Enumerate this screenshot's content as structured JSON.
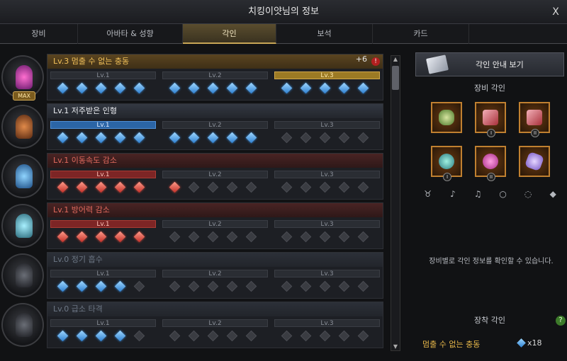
{
  "window": {
    "title": "치킹이얏님의 정보",
    "close": "X"
  },
  "tabs": [
    "장비",
    "아바타 & 성향",
    "각인",
    "보석",
    "카드"
  ],
  "engravings": [
    {
      "name": "Lv.3 멈출 수 없는 충동",
      "style": "gold",
      "bonus": "+6",
      "alert": "!",
      "avatar_max": "MAX",
      "segments": [
        {
          "label": "Lv.1",
          "gems": [
            "blue",
            "blue",
            "blue",
            "blue",
            "blue"
          ]
        },
        {
          "label": "Lv.2",
          "gems": [
            "blue",
            "blue",
            "blue",
            "blue",
            "blue"
          ]
        },
        {
          "label": "Lv.3",
          "fill": "gold",
          "gems": [
            "blue",
            "blue",
            "blue",
            "blue",
            "blue"
          ]
        }
      ]
    },
    {
      "name": "Lv.1 저주받은 인형",
      "style": "white",
      "segments": [
        {
          "label": "Lv.1",
          "fill": "blue",
          "gems": [
            "blue",
            "blue",
            "blue",
            "blue",
            "blue"
          ]
        },
        {
          "label": "Lv.2",
          "gems": [
            "blue",
            "blue",
            "blue",
            "blue",
            "blue"
          ]
        },
        {
          "label": "Lv.3",
          "gems": [
            "empty",
            "empty",
            "empty",
            "empty",
            "empty"
          ]
        }
      ]
    },
    {
      "name": "Lv.1 이동속도 감소",
      "style": "red",
      "segments": [
        {
          "label": "Lv.1",
          "fill": "red",
          "gems": [
            "red",
            "red",
            "red",
            "red",
            "red"
          ]
        },
        {
          "label": "Lv.2",
          "gems": [
            "red",
            "empty",
            "empty",
            "empty",
            "empty"
          ]
        },
        {
          "label": "Lv.3",
          "gems": [
            "empty",
            "empty",
            "empty",
            "empty",
            "empty"
          ]
        }
      ]
    },
    {
      "name": "Lv.1 방어력 감소",
      "style": "red",
      "segments": [
        {
          "label": "Lv.1",
          "fill": "red",
          "gems": [
            "red",
            "red",
            "red",
            "red",
            "red"
          ]
        },
        {
          "label": "Lv.2",
          "gems": [
            "empty",
            "empty",
            "empty",
            "empty",
            "empty"
          ]
        },
        {
          "label": "Lv.3",
          "gems": [
            "empty",
            "empty",
            "empty",
            "empty",
            "empty"
          ]
        }
      ]
    },
    {
      "name": "Lv.0 정기 흡수",
      "style": "grey",
      "segments": [
        {
          "label": "Lv.1",
          "gems": [
            "blue",
            "blue",
            "blue",
            "blue",
            "empty"
          ]
        },
        {
          "label": "Lv.2",
          "gems": [
            "empty",
            "empty",
            "empty",
            "empty",
            "empty"
          ]
        },
        {
          "label": "Lv.3",
          "gems": [
            "empty",
            "empty",
            "empty",
            "empty",
            "empty"
          ]
        }
      ]
    },
    {
      "name": "Lv.0 급소 타격",
      "style": "grey",
      "segments": [
        {
          "label": "Lv.1",
          "gems": [
            "blue",
            "blue",
            "blue",
            "blue",
            "empty"
          ]
        },
        {
          "label": "Lv.2",
          "gems": [
            "empty",
            "empty",
            "empty",
            "empty",
            "empty"
          ]
        },
        {
          "label": "Lv.3",
          "gems": [
            "empty",
            "empty",
            "empty",
            "empty",
            "empty"
          ]
        }
      ]
    }
  ],
  "right": {
    "guide_button": "각인 안내 보기",
    "equip_title": "장비 각인",
    "info": "장비별로 각인 정보를 확인할 수 있습니다.",
    "equipped_title": "장착 각인",
    "help": "?",
    "equipped_name": "멈출 수 없는 충동",
    "equipped_count": "x18",
    "badges": [
      "I",
      "II",
      "I",
      "II"
    ]
  },
  "colors": {
    "accent_gold": "#c8a656",
    "blue_gem": "#2d7fd0",
    "red_gem": "#c22f27"
  }
}
